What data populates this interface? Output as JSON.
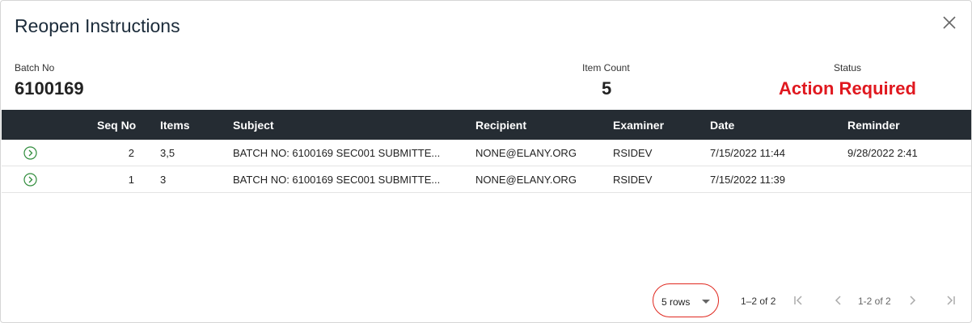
{
  "dialog": {
    "title": "Reopen Instructions"
  },
  "summary": {
    "batch_label": "Batch No",
    "batch_value": "6100169",
    "count_label": "Item Count",
    "count_value": "5",
    "status_label": "Status",
    "status_value": "Action Required",
    "status_color": "#e0181f"
  },
  "table": {
    "columns": [
      "Seq No",
      "Items",
      "Subject",
      "Recipient",
      "Examiner",
      "Date",
      "Reminder"
    ],
    "rows": [
      {
        "seq": "2",
        "items": "3,5",
        "subject": "BATCH NO: 6100169 SEC001 SUBMITTE...",
        "recipient": "NONE@ELANY.ORG",
        "examiner": "RSIDEV",
        "date": "7/15/2022 11:44",
        "reminder": "9/28/2022 2:41"
      },
      {
        "seq": "1",
        "items": "3",
        "subject": "BATCH NO: 6100169 SEC001 SUBMITTE...",
        "recipient": "NONE@ELANY.ORG",
        "examiner": "RSIDEV",
        "date": "7/15/2022 11:39",
        "reminder": ""
      }
    ],
    "header_bg": "#252c33",
    "expand_icon": "chevron-right-circle-icon",
    "expand_icon_color": "#2e8b3a"
  },
  "pagination": {
    "rows_per_page": "5 rows",
    "range": "1–2 of 2",
    "pages": "1-2 of 2",
    "icons": [
      "first-page-icon",
      "previous-page-icon",
      "next-page-icon",
      "last-page-icon"
    ],
    "highlight_color": "#e0281f"
  }
}
